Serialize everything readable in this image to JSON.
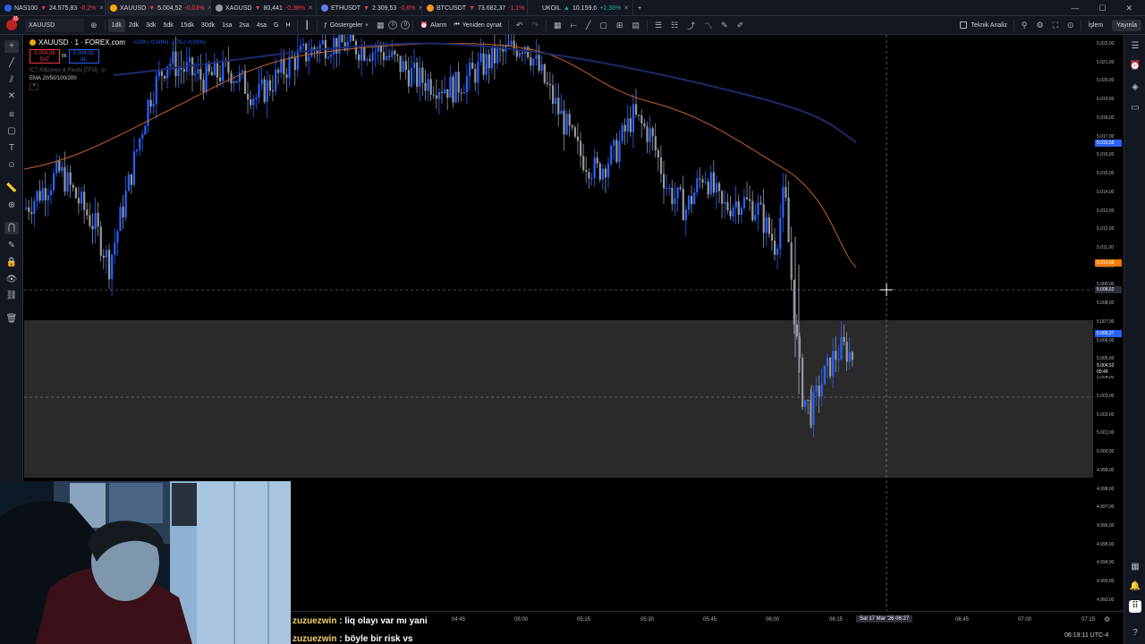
{
  "tabs": [
    {
      "symbol": "NAS100",
      "price": "24.575,83",
      "change": "-0,2%",
      "dot": "#2962ff",
      "up": false
    },
    {
      "symbol": "XAUUSD",
      "price": "5.004,52",
      "change": "-0,03%",
      "dot": "#f7a600",
      "up": false,
      "active": true
    },
    {
      "symbol": "XAGUSD",
      "price": "80,441",
      "change": "-0,38%",
      "dot": "#9598a1",
      "up": false
    },
    {
      "symbol": "ETHUSDT",
      "price": "2.309,53",
      "change": "-0,6%",
      "dot": "#627eea",
      "up": false
    },
    {
      "symbol": "BTCUSDT",
      "price": "73.682,37",
      "change": "-1,1%",
      "dot": "#f7931a",
      "up": false
    },
    {
      "symbol": "UKOIL",
      "price": "10.159,6",
      "change": "+2,38%",
      "dot": "#131722",
      "up": true
    }
  ],
  "toolbar": {
    "symbol": "XAUUSD",
    "intervals": [
      "1dk",
      "2dk",
      "3dk",
      "5dk",
      "15dk",
      "30dk",
      "1sa",
      "2sa",
      "4sa",
      "G",
      "H"
    ],
    "indicators_label": "Göstergeler",
    "alert_label": "Alarm",
    "replay_label": "Yeniden oynat",
    "badge_0": "0",
    "badge_1": "0",
    "tech_analysis_label": "Teknik Analiz",
    "trade_label": "İşlem",
    "publish_label": "Yayınla",
    "notification_count": "11"
  },
  "legend": {
    "title": "XAUUSD · 1 · FOREX.com",
    "change": "−0,09 (−0,00%)   -1,75 (−0,03%)",
    "sell_price": "5.004,06",
    "sell_label": "SAT",
    "spread": "86",
    "buy_price": "5.004,92",
    "buy_label": "AL",
    "indicator1": "ICT Killzones & Pivots [TFO]",
    "indicator2": "EMA 20/50/100/200"
  },
  "price_axis": {
    "labels": [
      "5.022,00",
      "5.021,00",
      "5.020,00",
      "5.019,00",
      "5.018,00",
      "5.017,00",
      "5.016,00",
      "5.015,00",
      "5.014,00",
      "5.013,00",
      "5.012,00",
      "5.011,00",
      "5.010,00",
      "5.009,00",
      "5.008,00",
      "5.007,00",
      "5.006,00",
      "5.005,00",
      "5.004,00",
      "5.003,00",
      "5.002,00",
      "5.001,00",
      "5.000,00",
      "4.999,00",
      "4.998,00",
      "4.997,00",
      "4.996,00",
      "4.995,00",
      "4.994,00",
      "4.993,00",
      "4.992,00",
      "4.991,00"
    ],
    "tag_blue": "5.016,58",
    "tag_orange": "5.010,08",
    "tag_crosshair": "5.008,62",
    "tag_blue2": "5.006,27",
    "tag_current": "5.004,52",
    "tag_countdown": "00:49"
  },
  "time_axis": {
    "labels": [
      "04:45",
      "05:00",
      "05:15",
      "05:30",
      "05:45",
      "06:00",
      "06:15",
      "06:45",
      "07:00",
      "07:15"
    ],
    "crosshair_label": "Sal 17 Mar '26   06:27"
  },
  "status": {
    "clock": "06:19:11 UTC-4"
  },
  "chat": [
    {
      "user": "zuzuezwin",
      "text": " : liq olayı var mı yani"
    },
    {
      "user": "zuzuezwin",
      "text": " : böyle bir risk vs"
    }
  ],
  "colors": {
    "bull": "#2962ff",
    "bear": "#9598a1",
    "ema_fast": "#c0622f",
    "ema_slow": "#1f2a6b",
    "zone": "#2a2a2a"
  }
}
